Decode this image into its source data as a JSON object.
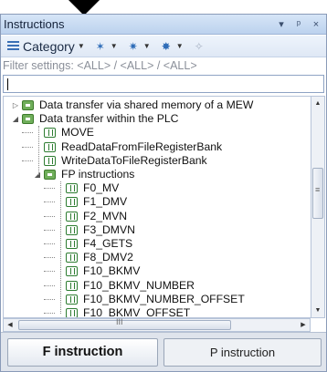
{
  "panel": {
    "title": "Instructions",
    "title_controls": [
      "▾",
      "ᵖ",
      "×"
    ]
  },
  "toolbar": {
    "category_label": "Category",
    "tools": [
      "wand-plus",
      "wand-down",
      "wand-dropdown",
      "wand-disabled"
    ]
  },
  "filter": {
    "text": "Filter settings: <ALL> / <ALL> / <ALL>"
  },
  "search": {
    "value": ""
  },
  "tree": {
    "items": [
      {
        "label": "Data transfer via shared memory of a MEW",
        "type": "folder",
        "level": 0,
        "expander": "collapsed"
      },
      {
        "label": "Data transfer within the PLC",
        "type": "folder",
        "level": 0,
        "expander": "expanded"
      },
      {
        "label": "MOVE",
        "type": "instruction",
        "level": 1,
        "expander": "none"
      },
      {
        "label": "ReadDataFromFileRegisterBank",
        "type": "instruction",
        "level": 1,
        "expander": "none"
      },
      {
        "label": "WriteDataToFileRegisterBank",
        "type": "instruction",
        "level": 1,
        "expander": "none"
      },
      {
        "label": "FP instructions",
        "type": "folder",
        "level": 1,
        "expander": "expanded"
      },
      {
        "label": "F0_MV",
        "type": "instruction",
        "level": 2,
        "expander": "none"
      },
      {
        "label": "F1_DMV",
        "type": "instruction",
        "level": 2,
        "expander": "none"
      },
      {
        "label": "F2_MVN",
        "type": "instruction",
        "level": 2,
        "expander": "none"
      },
      {
        "label": "F3_DMVN",
        "type": "instruction",
        "level": 2,
        "expander": "none"
      },
      {
        "label": "F4_GETS",
        "type": "instruction",
        "level": 2,
        "expander": "none"
      },
      {
        "label": "F8_DMV2",
        "type": "instruction",
        "level": 2,
        "expander": "none"
      },
      {
        "label": "F10_BKMV",
        "type": "instruction",
        "level": 2,
        "expander": "none"
      },
      {
        "label": "F10_BKMV_NUMBER",
        "type": "instruction",
        "level": 2,
        "expander": "none"
      },
      {
        "label": "F10_BKMV_NUMBER_OFFSET",
        "type": "instruction",
        "level": 2,
        "expander": "none"
      },
      {
        "label": "F10_BKMV_OFFSET",
        "type": "instruction",
        "level": 2,
        "expander": "none"
      }
    ]
  },
  "scrollbar": {
    "horizontal_grip": "III"
  },
  "tabs": [
    {
      "label": "F instruction",
      "active": true
    },
    {
      "label": "P instruction",
      "active": false
    }
  ]
}
